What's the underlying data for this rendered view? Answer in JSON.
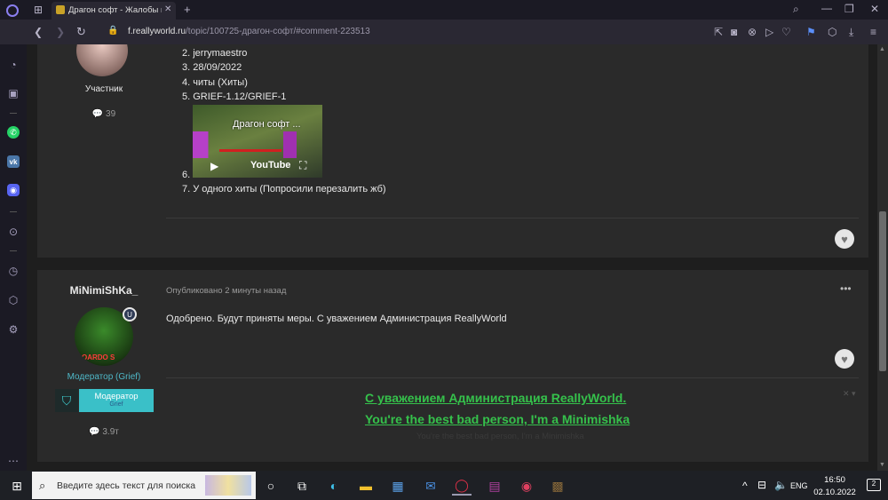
{
  "browser": {
    "tab_title": "Драгон софт - Жалобы на",
    "url_host": "f.reallyworld.ru",
    "url_path": "/topic/100725-драгон-софт/#comment-223513",
    "accent": "#7f5af0"
  },
  "post1": {
    "role": "Участник",
    "count": "39",
    "list": [
      "2.  jerrymaestro",
      "3. 28/09/2022",
      "4. читы (Хиты)",
      "5. GRIEF-1.12/GRIEF-1",
      "6.",
      "7. У одного хиты (Попросили перезалить жб)"
    ],
    "video": {
      "title": "Драгон софт ...",
      "brand": "YouTube"
    }
  },
  "post2": {
    "author": "MiNimiShKa_",
    "published": "Опубликовано 2 минуты назад",
    "message": "Одобрено. Будут приняты меры. С уважением Администрация ReallyWorld",
    "avatar_text": "OARDO S",
    "role": "Модератор (Grief)",
    "badge_title": "Модератор",
    "badge_sub": "Grief",
    "count": "3.9т",
    "signature_line1": "С уважением Администрация ReallyWorld.",
    "signature_line2": "You're the best bad person, I'm a Minimishka",
    "signature_alt": "You're the best bad person, I'm a Minimishka"
  },
  "taskbar": {
    "search_placeholder": "Введите здесь текст для поиска",
    "lang": "ENG",
    "time": "16:50",
    "date": "02.10.2022",
    "notif": "2"
  }
}
